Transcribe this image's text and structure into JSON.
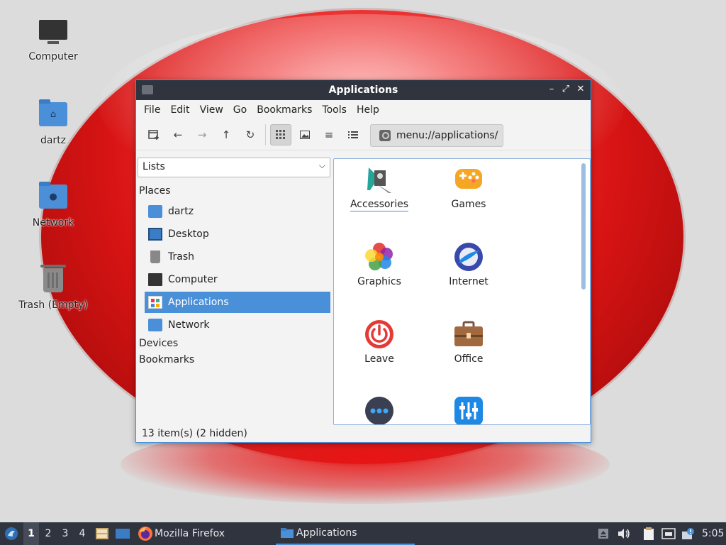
{
  "desktop": {
    "icons": [
      {
        "label": "Computer"
      },
      {
        "label": "dartz"
      },
      {
        "label": "Network"
      },
      {
        "label": "Trash (Empty)"
      }
    ]
  },
  "window": {
    "title": "Applications",
    "controls": {
      "minimize": "–",
      "maximize": "⤢",
      "close": "✕"
    },
    "menu": [
      "File",
      "Edit",
      "View",
      "Go",
      "Bookmarks",
      "Tools",
      "Help"
    ],
    "location": "menu://applications/",
    "sidepane": {
      "selector_value": "Lists",
      "places_heading": "Places",
      "places": [
        "dartz",
        "Desktop",
        "Trash",
        "Computer",
        "Applications",
        "Network"
      ],
      "selected_place": "Applications",
      "devices_heading": "Devices",
      "bookmarks_heading": "Bookmarks"
    },
    "apps": [
      {
        "label": "Accessories",
        "icon": "accessories-icon"
      },
      {
        "label": "Games",
        "icon": "games-icon"
      },
      {
        "label": "Graphics",
        "icon": "graphics-icon"
      },
      {
        "label": "Internet",
        "icon": "internet-icon"
      },
      {
        "label": "Leave",
        "icon": "leave-icon"
      },
      {
        "label": "Office",
        "icon": "office-icon"
      },
      {
        "label": "",
        "icon": "other-icon"
      },
      {
        "label": "",
        "icon": "preferences-icon"
      }
    ],
    "status": "13 item(s) (2 hidden)"
  },
  "panel": {
    "workspaces": [
      "1",
      "2",
      "3",
      "4"
    ],
    "active_workspace": "1",
    "tasks": [
      {
        "label": "Mozilla Firefox"
      },
      {
        "label": "Applications"
      }
    ],
    "clock": "5:05"
  },
  "colors": {
    "accent": "#4a90d9",
    "titlebar": "#2f343f",
    "panel": "#2f343f",
    "wallpaper_red": "#d91414"
  }
}
